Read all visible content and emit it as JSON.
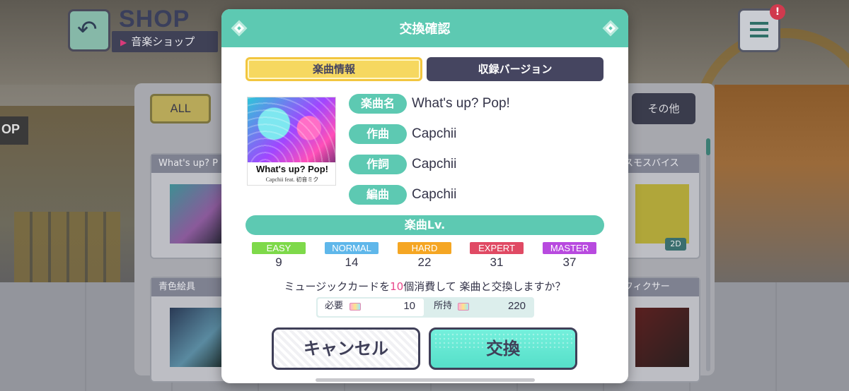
{
  "background": {
    "shop_title": "SHOP",
    "shop_subtitle": "音楽ショップ",
    "alert_badge": "!",
    "filter_all": "ALL",
    "filter_other": "その他",
    "cards": [
      {
        "caption": "What's up? P"
      },
      {
        "caption": "青色絵具"
      },
      {
        "caption": "スモスバイス",
        "badge": "2D"
      },
      {
        "caption": "フィクサー"
      }
    ]
  },
  "dialog": {
    "title": "交換確認",
    "tabs": {
      "song_info": "楽曲情報",
      "versions": "収録バージョン"
    },
    "jacket": {
      "title": "What's up? Pop!",
      "subtitle": "Capchii feat. 初音ミク"
    },
    "fields": [
      {
        "label": "楽曲名",
        "value": "What's up? Pop!"
      },
      {
        "label": "作曲",
        "value": "Capchii"
      },
      {
        "label": "作詞",
        "value": "Capchii"
      },
      {
        "label": "編曲",
        "value": "Capchii"
      }
    ],
    "level_header": "楽曲Lv.",
    "difficulties": [
      {
        "name": "EASY",
        "level": "9",
        "color": "#7ed94a"
      },
      {
        "name": "NORMAL",
        "level": "14",
        "color": "#5fb7ea"
      },
      {
        "name": "HARD",
        "level": "22",
        "color": "#f5a623"
      },
      {
        "name": "EXPERT",
        "level": "31",
        "color": "#e04a64"
      },
      {
        "name": "MASTER",
        "level": "37",
        "color": "#b84adf"
      }
    ],
    "confirm_prefix": "ミュージックカードを",
    "confirm_count": "10",
    "confirm_suffix": "個消費して 楽曲と交換しますか？",
    "cost": {
      "required_label": "必要",
      "required_value": "10",
      "owned_label": "所持",
      "owned_value": "220"
    },
    "buttons": {
      "cancel": "キャンセル",
      "exchange": "交換"
    }
  },
  "colors": {
    "accent": "#5dc9b2",
    "navy": "#454560",
    "tab_active": "#f6d860",
    "highlight": "#e8478b"
  }
}
